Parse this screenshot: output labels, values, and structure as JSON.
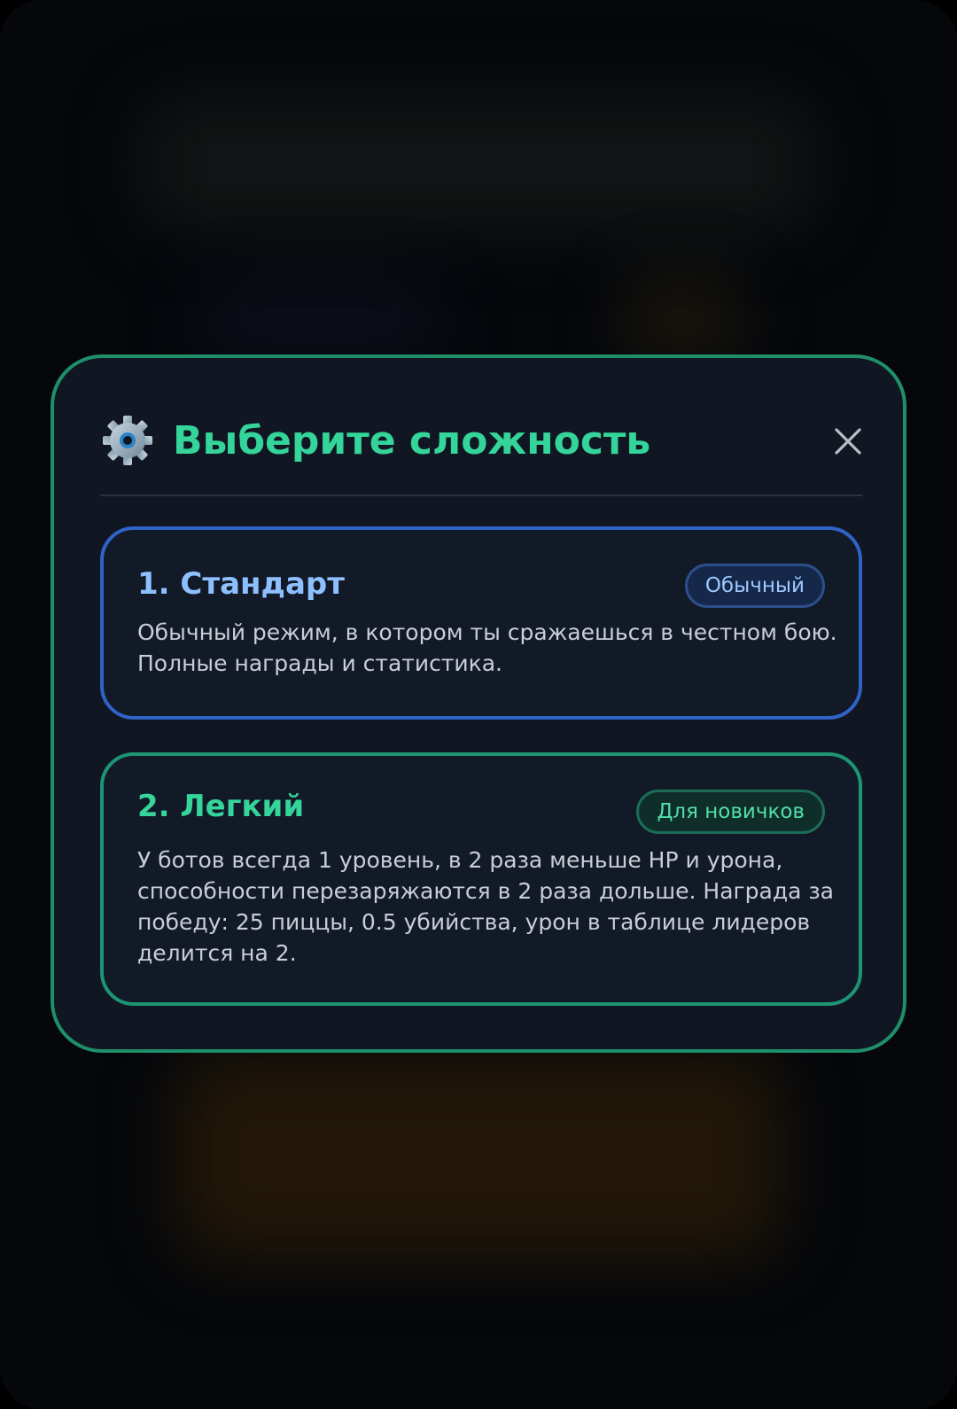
{
  "dialog": {
    "title": "Выберите сложность",
    "icon": "gear-icon",
    "close_icon": "close-icon",
    "accent_color": "#34d49a"
  },
  "options": [
    {
      "title": "1. Стандарт",
      "badge": "Обычный",
      "description": "Обычный режим, в котором ты сражаешься в честном бою. Полные награды и статистика.",
      "accent_color": "#2f63c8"
    },
    {
      "title": "2. Легкий",
      "badge": "Для новичков",
      "description": "У ботов всегда 1 уровень, в 2 раза меньше HP и урона, способности перезаряжаются в 2 раза дольше. Награда за победу: 25 пиццы, 0.5 убийства, урон в таблице лидеров делится на 2.",
      "accent_color": "#1d9573"
    }
  ]
}
